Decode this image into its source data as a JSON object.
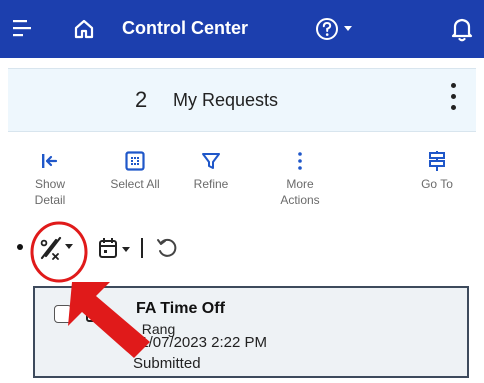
{
  "header": {
    "title": "Control Center",
    "menu_icon": "hamburger-menu-icon",
    "home_icon": "home-icon",
    "help_icon": "help-circle-icon",
    "notification_icon": "bell-icon"
  },
  "requests": {
    "count": "2",
    "label": "My Requests"
  },
  "actions": [
    {
      "label_line1": "Show",
      "label_line2": "Detail",
      "icon": "collapse-left-icon"
    },
    {
      "label_line1": "Select All",
      "label_line2": "",
      "icon": "select-all-icon"
    },
    {
      "label_line1": "Refine",
      "label_line2": "",
      "icon": "filter-icon"
    },
    {
      "label_line1": "More",
      "label_line2": "Actions",
      "icon": "more-vertical-icon"
    },
    {
      "label_line1": "Go To",
      "label_line2": "",
      "icon": "go-to-icon"
    }
  ],
  "toolbar": {
    "percent_icon": "percent-filter-icon",
    "calendar_icon": "calendar-filter-icon",
    "undo_icon": "undo-icon"
  },
  "card": {
    "title": "FA Time Off",
    "subtitle": ", Rang",
    "date": "11/07/2023 2:22 PM",
    "status": "Submitted"
  },
  "colors": {
    "header_bg": "#1c3fae",
    "accent": "#1f57c9",
    "annotation": "#e01a1a"
  }
}
